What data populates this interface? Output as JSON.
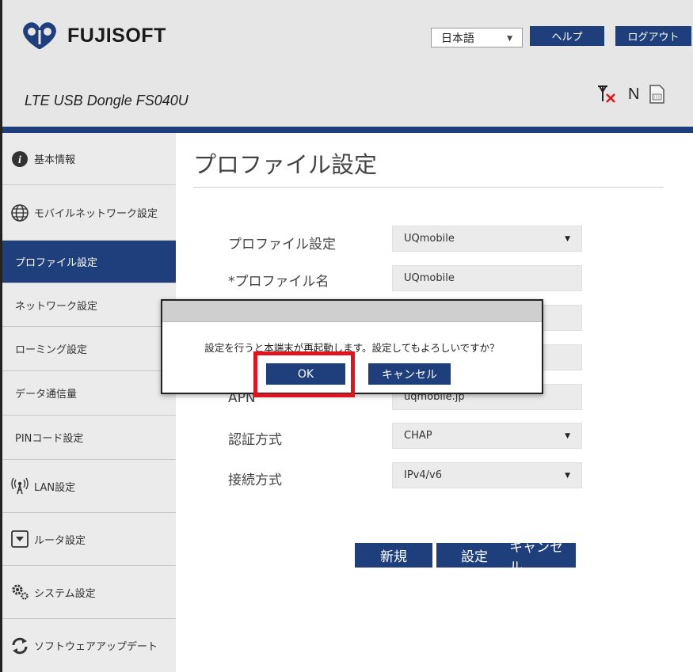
{
  "header": {
    "logo_text": "FUJISOFT",
    "model": "LTE USB Dongle FS040U",
    "language": "日本語",
    "help_label": "ヘルプ",
    "logout_label": "ログアウト",
    "network_letter": "N"
  },
  "sidebar": {
    "items": [
      {
        "label": "基本情報"
      },
      {
        "label": "モバイルネットワーク設定"
      },
      {
        "label": "プロファイル設定"
      },
      {
        "label": "ネットワーク設定"
      },
      {
        "label": "ローミング設定"
      },
      {
        "label": "データ通信量"
      },
      {
        "label": "PINコード設定"
      },
      {
        "label": "LAN設定"
      },
      {
        "label": "ルータ設定"
      },
      {
        "label": "システム設定"
      },
      {
        "label": "ソフトウェアアップデート"
      }
    ]
  },
  "main": {
    "title": "プロファイル設定",
    "rows": {
      "profile": {
        "label": "プロファイル設定",
        "value": "UQmobile"
      },
      "profile_name": {
        "label": "*プロファイル名",
        "value": "UQmobile"
      },
      "apn": {
        "label": "APN",
        "value": "uqmobile.jp"
      },
      "auth": {
        "label": "認証方式",
        "value": "CHAP"
      },
      "conn": {
        "label": "接続方式",
        "value": "IPv4/v6"
      }
    },
    "buttons": {
      "new": "新規",
      "apply": "設定",
      "cancel": "キャンセル"
    }
  },
  "dialog": {
    "message": "設定を行うと本端末が再起動します。設定してもよろしいですか？",
    "ok": "OK",
    "cancel": "キャンセル"
  },
  "colors": {
    "accent": "#1f3f7c",
    "highlight": "#e0141e",
    "sidebar_bg": "#ebebeb"
  }
}
